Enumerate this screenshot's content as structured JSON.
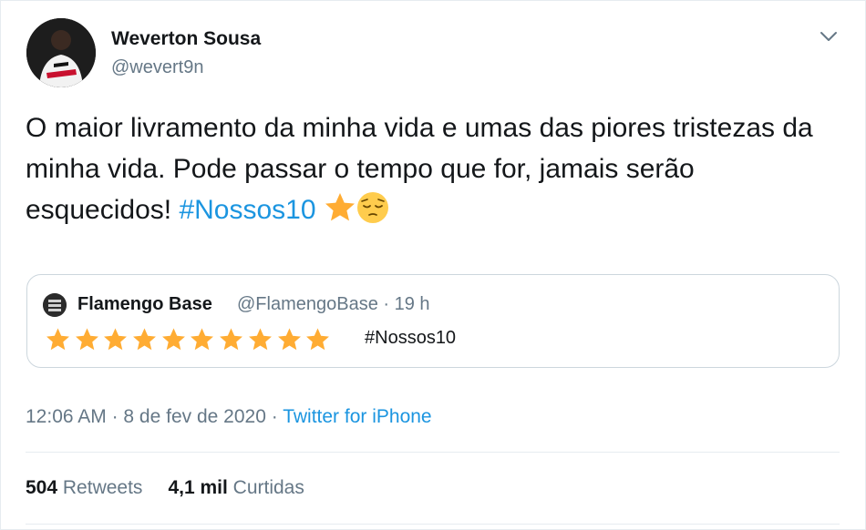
{
  "author": {
    "name": "Weverton Sousa",
    "handle": "@wevert9n"
  },
  "tweet": {
    "text_part1": "O maior livramento da minha vida e umas das piores tristezas da minha vida. Pode passar o tempo que for, jamais serão esquecidos! ",
    "hashtag": "#Nossos10",
    "emojis": [
      "star-emoji",
      "pensive-face-emoji"
    ]
  },
  "quote": {
    "name": "Flamengo Base",
    "handle": "@FlamengoBase",
    "separator": "·",
    "time": "19 h",
    "star_count": 10,
    "hashtag": "#Nossos10"
  },
  "meta": {
    "time": "12:06 AM",
    "separator1": "·",
    "date": "8 de fev de 2020",
    "separator2": "·",
    "source": "Twitter for iPhone"
  },
  "stats": {
    "retweets_count": "504",
    "retweets_label": "Retweets",
    "likes_count": "4,1 mil",
    "likes_label": "Curtidas"
  },
  "colors": {
    "link": "#1b95e0",
    "secondary_text": "#657786",
    "star": "#ffac33"
  }
}
